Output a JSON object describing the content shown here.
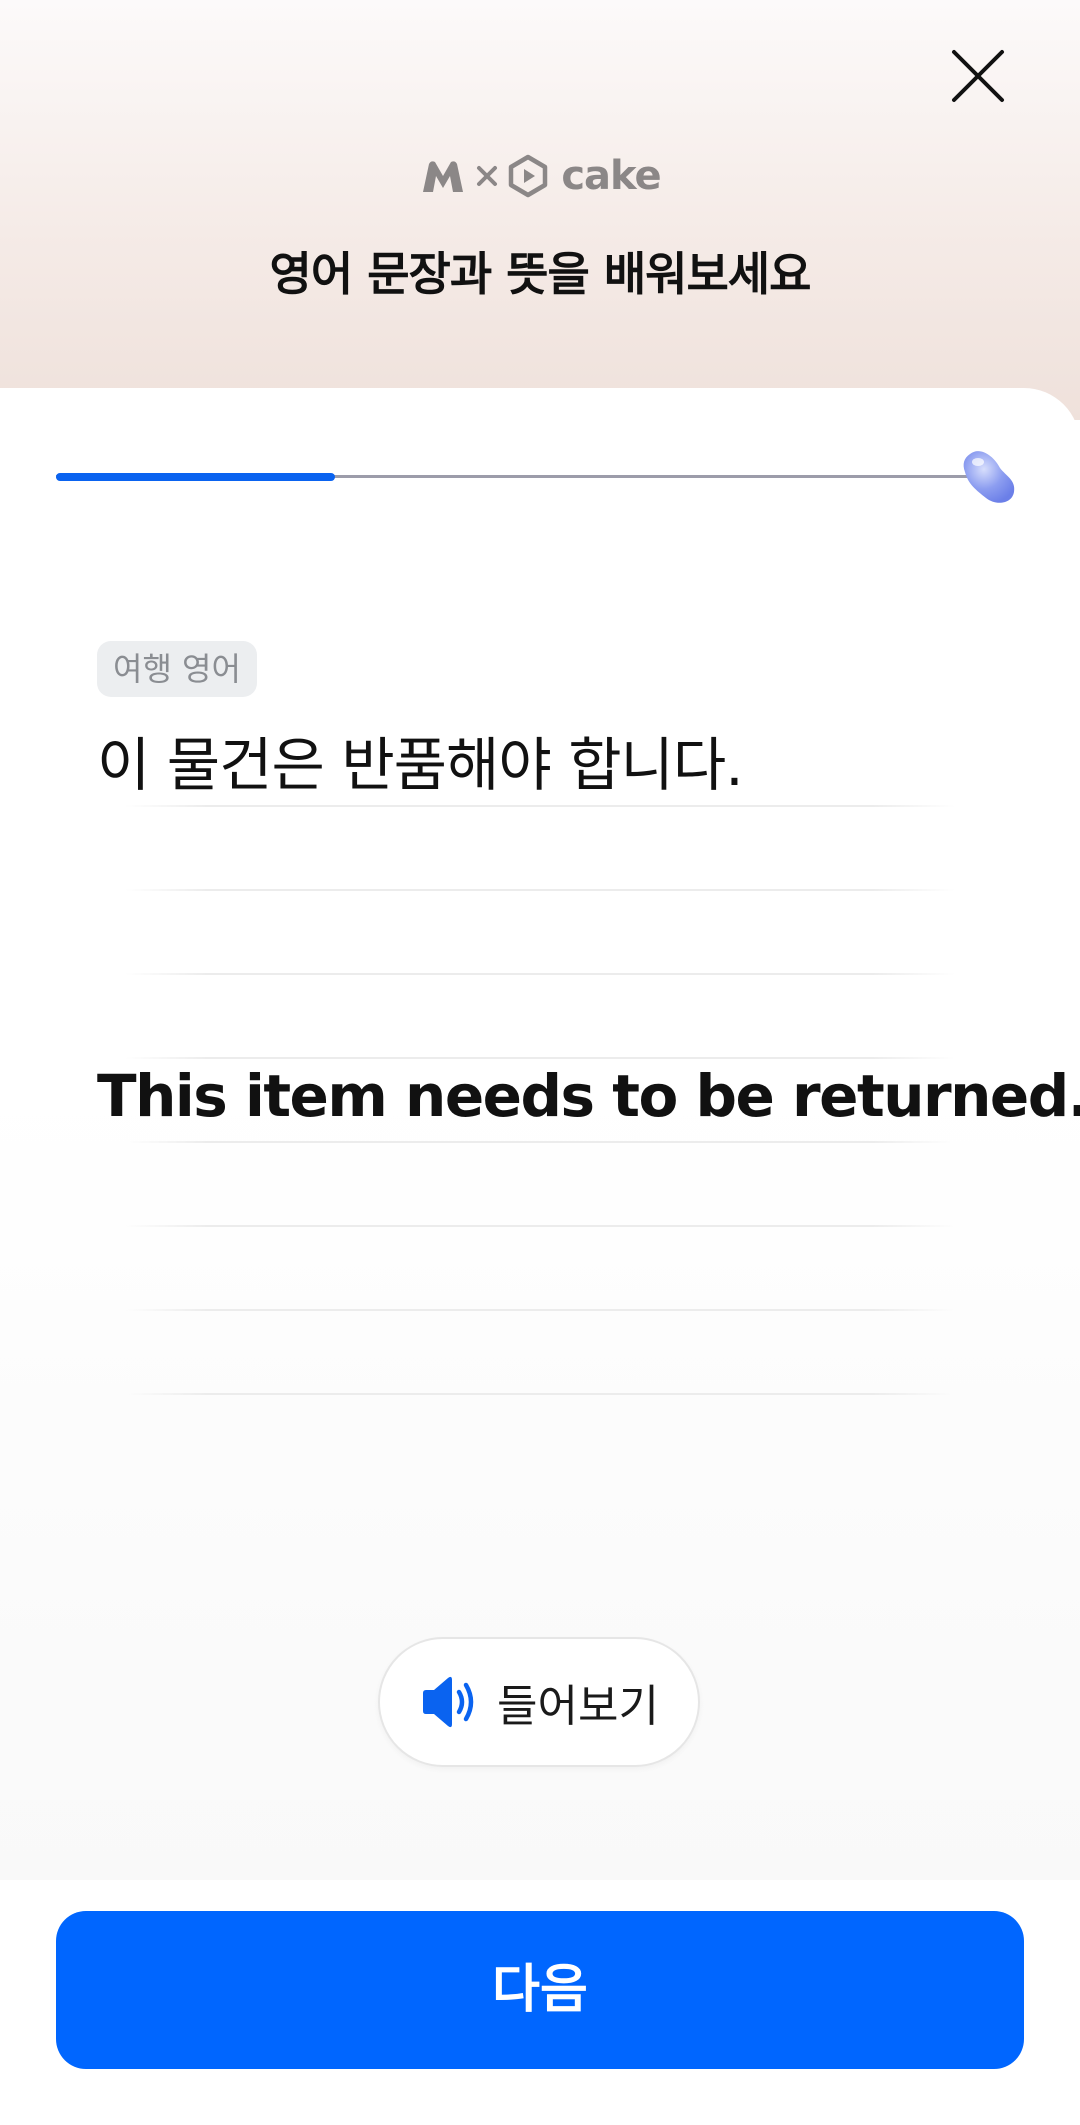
{
  "header": {
    "close_icon": "close-icon",
    "brand": {
      "logo_icon": "m-logo-icon",
      "separator_icon": "times-icon",
      "partner_icon": "cake-logo-icon",
      "partner_name": "cake"
    },
    "title": "영어 문장과 뜻을 배워보세요"
  },
  "progress": {
    "value": 0.3,
    "fill_color": "#0a63f0",
    "end_icon": "jellybean-icon"
  },
  "lesson": {
    "category": "여행 영어",
    "korean": "이 물건은 반품해야 합니다.",
    "english": "This item needs to be returned."
  },
  "listen_button": {
    "icon": "speaker-icon",
    "label": "들어보기"
  },
  "footer": {
    "next_label": "다음",
    "accent_color": "#0066ff"
  }
}
